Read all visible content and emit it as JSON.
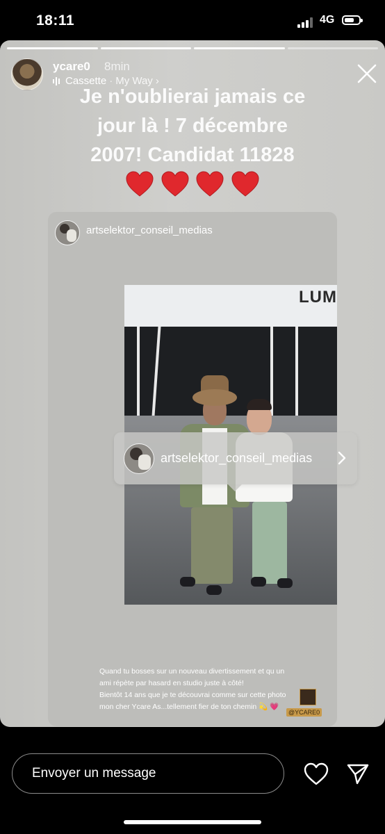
{
  "status_bar": {
    "time": "18:11",
    "network": "4G"
  },
  "story": {
    "progress_segments": [
      {
        "state": "done"
      },
      {
        "state": "done"
      },
      {
        "state": "done"
      },
      {
        "state": "active"
      }
    ],
    "user": {
      "username": "ycare0",
      "time_ago": "8min"
    },
    "music": {
      "title": "Cassette",
      "separator": "·",
      "song": "My Way",
      "chevron": "›"
    },
    "caption_lines": [
      "Je n'oublierai jamais ce",
      "jour là ! 7 décembre",
      "2007! Candidat 11828"
    ],
    "hearts": [
      "heart-emoji",
      "heart-emoji",
      "heart-emoji",
      "heart-emoji"
    ],
    "shared_post": {
      "author": "artselektor_conseil_medias",
      "photo_wall_text": "LUM",
      "mention_tag": "artselektor_conseil_medias",
      "caption_lines": [
        "Quand tu bosses sur un nouveau divertissement et qu un",
        "ami répète par hasard en studio juste à côté!",
        "Bientôt 14 ans que je te découvrai comme sur cette photo",
        "mon cher Ycare As...tellement fier de ton chemin 💫 💗"
      ],
      "handle_badge": "@YCARE0"
    },
    "close_icon": "close-icon"
  },
  "reply_bar": {
    "placeholder": "Envoyer un message",
    "like_icon": "heart-outline-icon",
    "send_icon": "paper-plane-icon"
  },
  "colors": {
    "heart": "#e0282d",
    "story_bg": "#c9c9c6",
    "background": "#000000"
  }
}
